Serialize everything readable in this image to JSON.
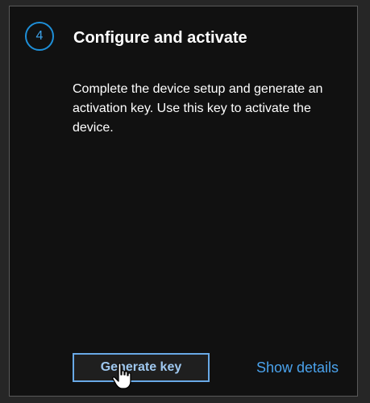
{
  "card": {
    "step_number": "4",
    "title": "Configure and activate",
    "description": "Complete the device setup and generate an activation key. Use this key to activate the device.",
    "generate_button_label": "Generate key",
    "show_details_label": "Show details"
  },
  "cursor": {
    "icon": "hand-pointer-icon"
  },
  "colors": {
    "accent": "#1e8fd8",
    "link": "#4aa2ec",
    "card_background": "#111111",
    "button_border": "#69a9e6"
  }
}
